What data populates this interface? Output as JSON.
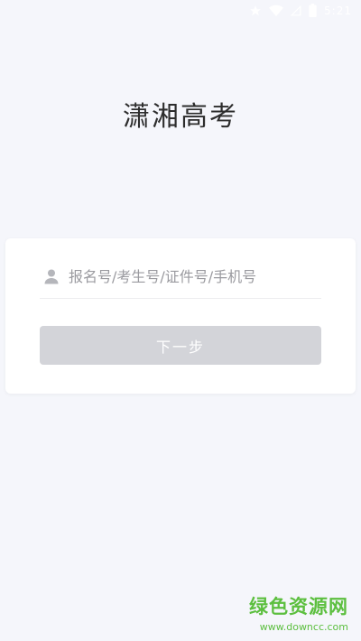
{
  "status_bar": {
    "time": "5:21",
    "icons": [
      "star-icon",
      "wifi-icon",
      "signal-icon",
      "battery-icon"
    ]
  },
  "app": {
    "title": "潇湘高考"
  },
  "login": {
    "id_placeholder": "报名号/考生号/证件号/手机号",
    "id_value": "",
    "next_label": "下一步",
    "button_color": "#d3d4d9"
  },
  "watermark": {
    "name": "绿色资源网",
    "url": "www.downcc.com",
    "color": "#5cbf3f"
  }
}
